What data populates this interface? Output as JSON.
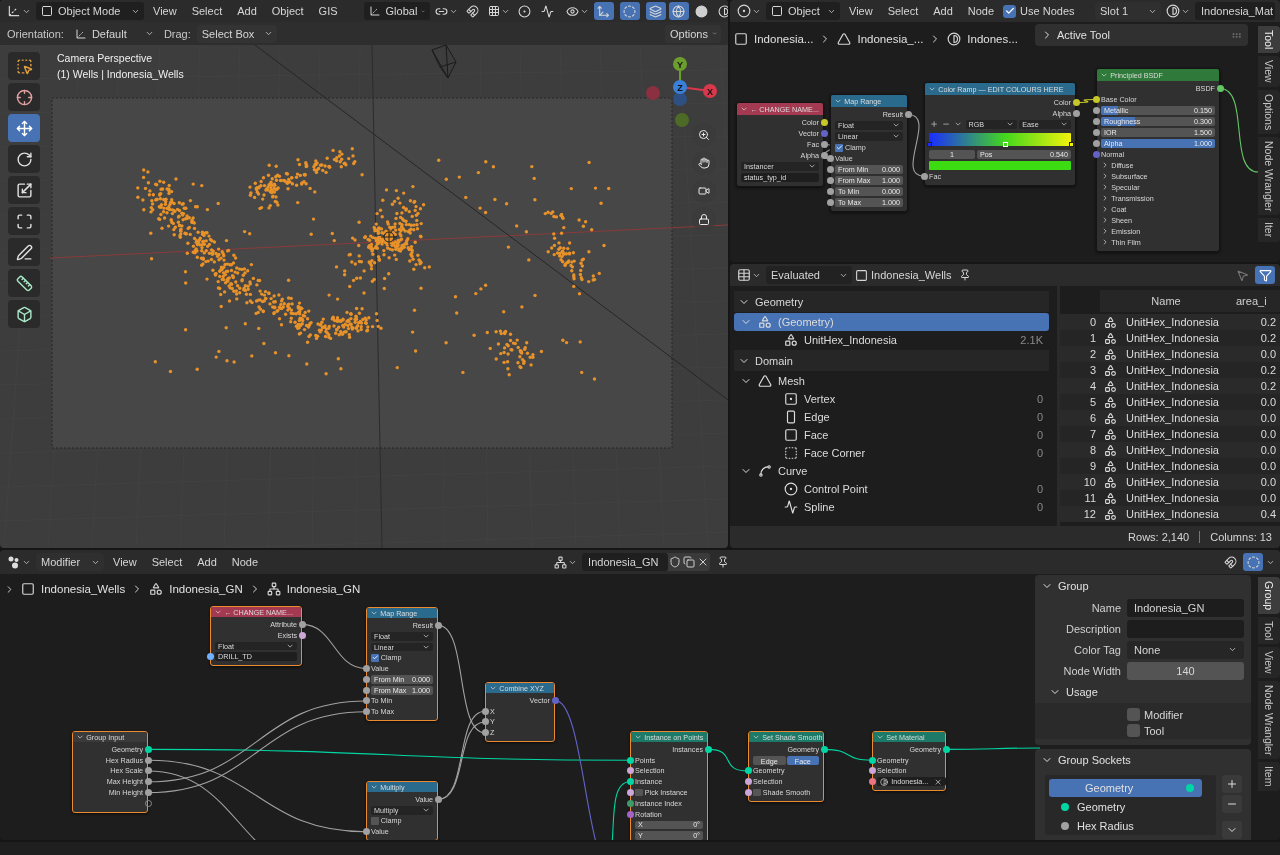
{
  "viewport": {
    "header": {
      "mode": "Object Mode",
      "menus": [
        "View",
        "Select",
        "Add",
        "Object",
        "GIS"
      ],
      "orientation": "Global",
      "toggles": [
        {
          "kind": "gizmos",
          "on": true
        },
        {
          "kind": "overlays",
          "on": true
        },
        {
          "kind": "xray",
          "on": true
        }
      ],
      "shading": [
        {
          "kind": "wireframe",
          "selected": true
        },
        {
          "kind": "solid",
          "selected": false
        },
        {
          "kind": "material",
          "selected": false
        }
      ]
    },
    "tool_settings": {
      "orientation_label": "Orientation:",
      "orientation": "Default",
      "drag_label": "Drag:",
      "drag": "Select Box",
      "options": "Options"
    },
    "overlay": {
      "view_name": "Camera Perspective",
      "object_info": "(1) Wells | Indonesia_Wells"
    },
    "tools": [
      {
        "kind": "select_box",
        "selected": false
      },
      {
        "kind": "cursor",
        "selected": false
      },
      {
        "kind": "move",
        "selected": true
      },
      {
        "kind": "rotate",
        "selected": false
      },
      {
        "kind": "scale",
        "selected": false
      },
      {
        "kind": "transform",
        "selected": false
      },
      {
        "kind": "annotate",
        "selected": false
      },
      {
        "kind": "measure",
        "selected": false
      },
      {
        "kind": "add_cube",
        "selected": false
      }
    ],
    "gizmo": {
      "y": "Y",
      "z": "Z",
      "x": "X"
    }
  },
  "shader_editor": {
    "header": {
      "object": "Object",
      "menus": [
        "View",
        "Select",
        "Add",
        "Node"
      ],
      "use_nodes": {
        "label": "Use Nodes",
        "checked": true
      },
      "slot": "Slot 1",
      "material": "Indonesia_Mat"
    },
    "breadcrumbs": [
      {
        "kind": "object",
        "label": "Indonesia..."
      },
      {
        "kind": "mesh",
        "label": "Indonesia_..."
      },
      {
        "kind": "material",
        "label": "Indones..."
      }
    ],
    "active_tool": {
      "label": "Active Tool",
      "expanded": false
    },
    "tabs": [
      {
        "label": "Tool",
        "selected": true
      },
      {
        "label": "View",
        "selected": false
      },
      {
        "label": "Options",
        "selected": false
      },
      {
        "label": "Node Wrangler",
        "selected": false
      },
      {
        "label": "Iter",
        "selected": false
      }
    ],
    "nodes": [
      {
        "title": "← CHANGE NAME...",
        "color": "#a33a52",
        "selected": false,
        "rows": [
          {
            "kind": "output",
            "label": "Color",
            "socket": {
              "color": "#c7c729"
            }
          },
          {
            "kind": "output",
            "label": "Vector",
            "socket": {
              "color": "#6363c7"
            }
          },
          {
            "kind": "output",
            "label": "Fac",
            "socket": {
              "color": "#a1a1a1"
            }
          },
          {
            "kind": "output",
            "label": "Alpha",
            "socket": {
              "color": "#a1a1a1"
            }
          },
          {
            "kind": "dropdown",
            "value": "Instancer"
          },
          {
            "kind": "text",
            "value": "status_typ_id"
          }
        ]
      },
      {
        "title": "Map Range",
        "color": "#2a6a8c",
        "selected": false,
        "rows": [
          {
            "kind": "output",
            "label": "Result",
            "socket": {
              "color": "#a1a1a1"
            }
          },
          {
            "kind": "dropdown",
            "value": "Float"
          },
          {
            "kind": "dropdown",
            "value": "Linear"
          },
          {
            "kind": "checkbox",
            "label": "Clamp",
            "checked": true
          },
          {
            "kind": "input",
            "label": "Value",
            "socket": {
              "color": "#a1a1a1"
            }
          },
          {
            "kind": "field",
            "label": "From Min",
            "value": "0.000",
            "socket": {
              "color": "#a1a1a1"
            }
          },
          {
            "kind": "field",
            "label": "From Max",
            "value": "1.000",
            "socket": {
              "color": "#a1a1a1"
            }
          },
          {
            "kind": "field",
            "label": "To Min",
            "value": "0.000",
            "socket": {
              "color": "#a1a1a1"
            }
          },
          {
            "kind": "field",
            "label": "To Max",
            "value": "1.000",
            "socket": {
              "color": "#a1a1a1"
            }
          }
        ]
      },
      {
        "title": "Color Ramp — EDIT COLOURS HERE",
        "color": "#2a6a8c",
        "selected": false,
        "rows": [
          {
            "kind": "output",
            "label": "Color",
            "socket": {
              "color": "#c7c729"
            }
          },
          {
            "kind": "output",
            "label": "Alpha",
            "socket": {
              "color": "#a1a1a1"
            }
          },
          {
            "kind": "ramp_tools",
            "color_mode": "RGB",
            "interpolation": "Ease"
          },
          {
            "kind": "gradient",
            "stops": [
              {
                "color": "#1a2cff",
                "level": 0,
                "selected": false
              },
              {
                "color": "#44d81c",
                "level": 0.54,
                "selected": true
              },
              {
                "color": "#f2f20c",
                "level": 1,
                "selected": false
              }
            ]
          },
          {
            "kind": "stop",
            "index": "1",
            "label": "Pos",
            "value": "0.540"
          },
          {
            "kind": "swatch",
            "color": "#3ddc12"
          },
          {
            "kind": "input",
            "label": "Fac",
            "socket": {
              "color": "#a1a1a1"
            }
          }
        ]
      },
      {
        "title": "Principled BSDF",
        "color": "#2f7a3a",
        "selected": false,
        "rows": [
          {
            "kind": "output",
            "label": "BSDF",
            "socket": {
              "color": "#63c763"
            }
          },
          {
            "kind": "input",
            "label": "Base Color",
            "socket": {
              "color": "#c7c729"
            }
          },
          {
            "kind": "slider",
            "label": "Metallic",
            "value": "0.150",
            "level": 0.15,
            "socket": {
              "color": "#a1a1a1"
            }
          },
          {
            "kind": "slider",
            "label": "Roughness",
            "value": "0.300",
            "level": 0.3,
            "socket": {
              "color": "#a1a1a1"
            }
          },
          {
            "kind": "field",
            "label": "IOR",
            "value": "1.500",
            "socket": {
              "color": "#a1a1a1"
            }
          },
          {
            "kind": "slider",
            "label": "Alpha",
            "value": "1.000",
            "level": 1,
            "socket": {
              "color": "#a1a1a1"
            }
          },
          {
            "kind": "input",
            "label": "Normal",
            "socket": {
              "color": "#6363c7"
            }
          },
          {
            "kind": "panel",
            "label": "Diffuse"
          },
          {
            "kind": "panel",
            "label": "Subsurface"
          },
          {
            "kind": "panel",
            "label": "Specular"
          },
          {
            "kind": "panel",
            "label": "Transmission"
          },
          {
            "kind": "panel",
            "label": "Coat"
          },
          {
            "kind": "panel",
            "label": "Sheen"
          },
          {
            "kind": "panel",
            "label": "Emission"
          },
          {
            "kind": "panel",
            "label": "Thin Film"
          }
        ]
      }
    ]
  },
  "spreadsheet": {
    "header": {
      "mode": "Evaluated",
      "object": "Indonesia_Wells",
      "toggles": [
        {
          "kind": "selection",
          "on": false
        },
        {
          "kind": "filter",
          "on": true
        }
      ]
    },
    "tree": [
      {
        "kind": "section",
        "label": "Geometry",
        "expanded": true,
        "children": [
          {
            "kind": "instances",
            "label": "(Geometry)",
            "expanded": true,
            "selected": true,
            "children": [
              {
                "kind": "instances",
                "label": "UnitHex_Indonesia",
                "count": "2.1K",
                "selected": false
              }
            ]
          }
        ]
      },
      {
        "kind": "section",
        "label": "Domain",
        "expanded": true,
        "children": [
          {
            "kind": "mesh",
            "label": "Mesh",
            "expanded": true,
            "selected": false,
            "children": [
              {
                "kind": "vertex",
                "label": "Vertex",
                "count": "0",
                "selected": false
              },
              {
                "kind": "edge",
                "label": "Edge",
                "count": "0",
                "selected": false
              },
              {
                "kind": "face",
                "label": "Face",
                "count": "0",
                "selected": false
              },
              {
                "kind": "face_corner",
                "label": "Face Corner",
                "count": "0",
                "selected": false
              }
            ]
          },
          {
            "kind": "curve",
            "label": "Curve",
            "expanded": true,
            "selected": false,
            "children": [
              {
                "kind": "control_point",
                "label": "Control Point",
                "count": "0",
                "selected": false
              },
              {
                "kind": "spline",
                "label": "Spline",
                "count": "0",
                "selected": false
              }
            ]
          }
        ]
      }
    ],
    "table": {
      "columns": [
        "Name",
        "area_i"
      ],
      "rows": [
        {
          "index": "0",
          "name": "UnitHex_Indonesia",
          "area": "0.2"
        },
        {
          "index": "1",
          "name": "UnitHex_Indonesia",
          "area": "0.2"
        },
        {
          "index": "2",
          "name": "UnitHex_Indonesia",
          "area": "0.0"
        },
        {
          "index": "3",
          "name": "UnitHex_Indonesia",
          "area": "0.2"
        },
        {
          "index": "4",
          "name": "UnitHex_Indonesia",
          "area": "0.2"
        },
        {
          "index": "5",
          "name": "UnitHex_Indonesia",
          "area": "0.0"
        },
        {
          "index": "6",
          "name": "UnitHex_Indonesia",
          "area": "0.0"
        },
        {
          "index": "7",
          "name": "UnitHex_Indonesia",
          "area": "0.0"
        },
        {
          "index": "8",
          "name": "UnitHex_Indonesia",
          "area": "0.0"
        },
        {
          "index": "9",
          "name": "UnitHex_Indonesia",
          "area": "0.0"
        },
        {
          "index": "10",
          "name": "UnitHex_Indonesia",
          "area": "0.0"
        },
        {
          "index": "11",
          "name": "UnitHex_Indonesia",
          "area": "0.0"
        },
        {
          "index": "12",
          "name": "UnitHex_Indonesia",
          "area": "0.4"
        }
      ]
    },
    "footer": {
      "rows": "Rows: 2,140",
      "columns": "Columns: 13"
    }
  },
  "geometry_nodes": {
    "header": {
      "context": "Modifier",
      "menus": [
        "View",
        "Select",
        "Add",
        "Node"
      ],
      "node_group": "Indonesia_GN"
    },
    "breadcrumbs": [
      {
        "kind": "object",
        "label": "Indonesia_Wells"
      },
      {
        "kind": "modifier",
        "label": "Indonesia_GN"
      },
      {
        "kind": "node_tree",
        "label": "Indonesia_GN"
      }
    ],
    "tabs": [
      {
        "label": "Group",
        "selected": true
      },
      {
        "label": "Tool",
        "selected": false
      },
      {
        "label": "View",
        "selected": false
      },
      {
        "label": "Node Wrangler",
        "selected": false
      },
      {
        "label": "Item",
        "selected": false
      }
    ],
    "nodes": [
      {
        "title": "← CHANGE NAME...",
        "color": "#a33a52",
        "selected": true,
        "rows": [
          {
            "kind": "output",
            "label": "Attribute",
            "socket": {
              "color": "#a1a1a1"
            }
          },
          {
            "kind": "output",
            "label": "Exists",
            "socket": {
              "color": "#cca6d6"
            }
          },
          {
            "kind": "dropdown",
            "value": "Float"
          },
          {
            "kind": "text",
            "value": "DRILL_TD",
            "socket": {
              "color": "#70b2ff"
            }
          }
        ]
      },
      {
        "title": "Map Range",
        "color": "#2a6a8c",
        "selected": true,
        "rows": [
          {
            "kind": "output",
            "label": "Result",
            "socket": {
              "color": "#a1a1a1"
            }
          },
          {
            "kind": "dropdown",
            "value": "Float"
          },
          {
            "kind": "dropdown",
            "value": "Linear"
          },
          {
            "kind": "checkbox",
            "label": "Clamp",
            "checked": true
          },
          {
            "kind": "input",
            "label": "Value",
            "socket": {
              "color": "#a1a1a1"
            }
          },
          {
            "kind": "field",
            "label": "From Min",
            "value": "0.000",
            "socket": {
              "color": "#a1a1a1"
            }
          },
          {
            "kind": "field",
            "label": "From Max",
            "value": "1.000",
            "socket": {
              "color": "#a1a1a1"
            }
          },
          {
            "kind": "input",
            "label": "To Min",
            "socket": {
              "color": "#a1a1a1"
            }
          },
          {
            "kind": "input",
            "label": "To Max",
            "socket": {
              "color": "#a1a1a1"
            }
          }
        ]
      },
      {
        "title": "Combine XYZ",
        "color": "#2a6a8c",
        "selected": true,
        "rows": [
          {
            "kind": "output",
            "label": "Vector",
            "socket": {
              "color": "#6363c7"
            }
          },
          {
            "kind": "input",
            "label": "X",
            "socket": {
              "color": "#a1a1a1"
            }
          },
          {
            "kind": "input",
            "label": "Y",
            "socket": {
              "color": "#a1a1a1"
            }
          },
          {
            "kind": "input",
            "label": "Z",
            "socket": {
              "color": "#a1a1a1"
            }
          }
        ]
      },
      {
        "title": "Group Input",
        "color": "#3a3a3a",
        "selected": true,
        "rows": [
          {
            "kind": "output",
            "label": "Geometry",
            "socket": {
              "color": "#00d6a3"
            }
          },
          {
            "kind": "output",
            "label": "Hex Radius",
            "socket": {
              "color": "#a1a1a1"
            }
          },
          {
            "kind": "output",
            "label": "Hex Scale",
            "socket": {
              "color": "#a1a1a1"
            }
          },
          {
            "kind": "output",
            "label": "Max Height",
            "socket": {
              "color": "#a1a1a1"
            }
          },
          {
            "kind": "output",
            "label": "Min Height",
            "socket": {
              "color": "#a1a1a1"
            }
          },
          {
            "kind": "virtual"
          }
        ]
      },
      {
        "title": "Multiply",
        "color": "#2a6a8c",
        "selected": true,
        "rows": [
          {
            "kind": "output",
            "label": "Value",
            "socket": {
              "color": "#a1a1a1"
            }
          },
          {
            "kind": "dropdown",
            "value": "Multiply"
          },
          {
            "kind": "checkbox",
            "label": "Clamp",
            "checked": false
          },
          {
            "kind": "input",
            "label": "Value",
            "socket": {
              "color": "#a1a1a1"
            }
          }
        ]
      },
      {
        "title": "Instance on Points",
        "color": "#1d7a68",
        "selected": true,
        "rows": [
          {
            "kind": "output",
            "label": "Instances",
            "socket": {
              "color": "#00d6a3"
            }
          },
          {
            "kind": "input",
            "label": "Points",
            "socket": {
              "color": "#00d6a3"
            }
          },
          {
            "kind": "input",
            "label": "Selection",
            "socket": {
              "color": "#cca6d6"
            }
          },
          {
            "kind": "input",
            "label": "Instance",
            "socket": {
              "color": "#00d6a3"
            }
          },
          {
            "kind": "checkbox",
            "label": "Pick Instance",
            "checked": false,
            "socket": {
              "color": "#cca6d6"
            }
          },
          {
            "kind": "input",
            "label": "Instance Index",
            "socket": {
              "color": "#3f9a6a"
            }
          },
          {
            "kind": "input",
            "label": "Rotation",
            "socket": {
              "color": "#a563c7"
            }
          },
          {
            "kind": "field",
            "label": "X",
            "value": "0°"
          },
          {
            "kind": "field",
            "label": "Y",
            "value": "0°"
          }
        ]
      },
      {
        "title": "Set Shade Smooth",
        "color": "#1d7a68",
        "selected": true,
        "rows": [
          {
            "kind": "output",
            "label": "Geometry",
            "socket": {
              "color": "#00d6a3"
            }
          },
          {
            "kind": "toggle",
            "options": [
              {
                "label": "Edge",
                "selected": false
              },
              {
                "label": "Face",
                "selected": true
              }
            ]
          },
          {
            "kind": "input",
            "label": "Geometry",
            "socket": {
              "color": "#00d6a3"
            }
          },
          {
            "kind": "input",
            "label": "Selection",
            "socket": {
              "color": "#cca6d6"
            }
          },
          {
            "kind": "checkbox",
            "label": "Shade Smooth",
            "checked": false,
            "socket": {
              "color": "#cca6d6"
            }
          }
        ]
      },
      {
        "title": "Set Material",
        "color": "#1d7a68",
        "selected": true,
        "rows": [
          {
            "kind": "output",
            "label": "Geometry",
            "socket": {
              "color": "#00d6a3"
            }
          },
          {
            "kind": "input",
            "label": "Geometry",
            "socket": {
              "color": "#00d6a3"
            }
          },
          {
            "kind": "input",
            "label": "Selection",
            "socket": {
              "color": "#cca6d6"
            }
          },
          {
            "kind": "material",
            "value": "Indonesia...",
            "socket": {
              "color": "#eb7582"
            }
          }
        ]
      }
    ],
    "side_panel": {
      "group": {
        "title": "Group",
        "expanded": true,
        "fields": [
          {
            "kind": "text",
            "label": "Name",
            "value": "Indonesia_GN"
          },
          {
            "kind": "text",
            "label": "Description"
          },
          {
            "kind": "dropdown",
            "label": "Color Tag",
            "value": "None"
          },
          {
            "kind": "number",
            "label": "Node Width",
            "value": "140"
          }
        ],
        "usage": {
          "title": "Usage",
          "expanded": true,
          "options": [
            {
              "label": "Modifier",
              "checked": false
            },
            {
              "label": "Tool",
              "checked": false
            }
          ]
        }
      },
      "sockets": {
        "title": "Group Sockets",
        "expanded": true,
        "items": [
          {
            "kind": "output",
            "label": "Geometry",
            "socket": {
              "color": "#00d6a3"
            },
            "selected": true
          },
          {
            "kind": "input",
            "label": "Geometry",
            "socket": {
              "color": "#00d6a3"
            },
            "selected": false
          },
          {
            "kind": "input",
            "label": "Hex Radius",
            "socket": {
              "color": "#a1a1a1"
            },
            "selected": false
          }
        ]
      }
    }
  }
}
